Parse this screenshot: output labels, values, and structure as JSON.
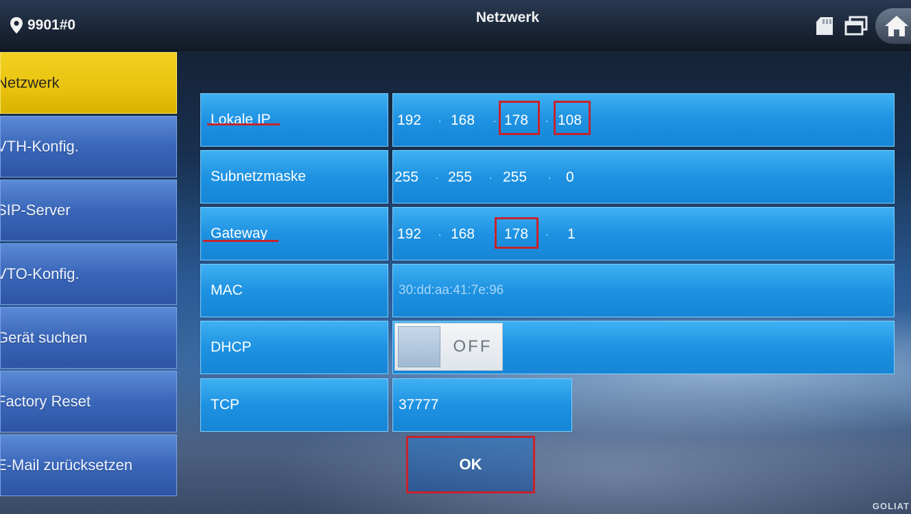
{
  "header": {
    "room_id": "9901#0",
    "title": "Netzwerk",
    "icons": [
      "location-pin-icon",
      "sd-card-icon",
      "windows-icon",
      "home-icon"
    ]
  },
  "sidebar": {
    "items": [
      {
        "label": "Netzwerk",
        "active": true
      },
      {
        "label": "VTH-Konfig.",
        "active": false
      },
      {
        "label": "SIP-Server",
        "active": false
      },
      {
        "label": "VTO-Konfig.",
        "active": false
      },
      {
        "label": "Gerät suchen",
        "active": false
      },
      {
        "label": "Factory Reset",
        "active": false
      },
      {
        "label": "E-Mail zurücksetzen",
        "active": false
      }
    ]
  },
  "form": {
    "local_ip": {
      "label": "Lokale IP",
      "octets": [
        "192",
        "168",
        "178",
        "108"
      ]
    },
    "subnet": {
      "label": "Subnetzmaske",
      "octets": [
        "255",
        "255",
        "255",
        "0"
      ]
    },
    "gateway": {
      "label": "Gateway",
      "octets": [
        "192",
        "168",
        "178",
        "1"
      ]
    },
    "mac": {
      "label": "MAC",
      "value": "30:dd:aa:41:7e:96"
    },
    "dhcp": {
      "label": "DHCP",
      "state": "OFF"
    },
    "tcp": {
      "label": "TCP",
      "value": "37777"
    },
    "separator": "."
  },
  "ok_label": "OK",
  "watermark": "GOLIAT",
  "colors": {
    "active_tab": "#e8c20e",
    "field_blue": "#1e92e2",
    "sidebar_blue": "#3a66b8",
    "annotation_red": "#c8222a"
  }
}
